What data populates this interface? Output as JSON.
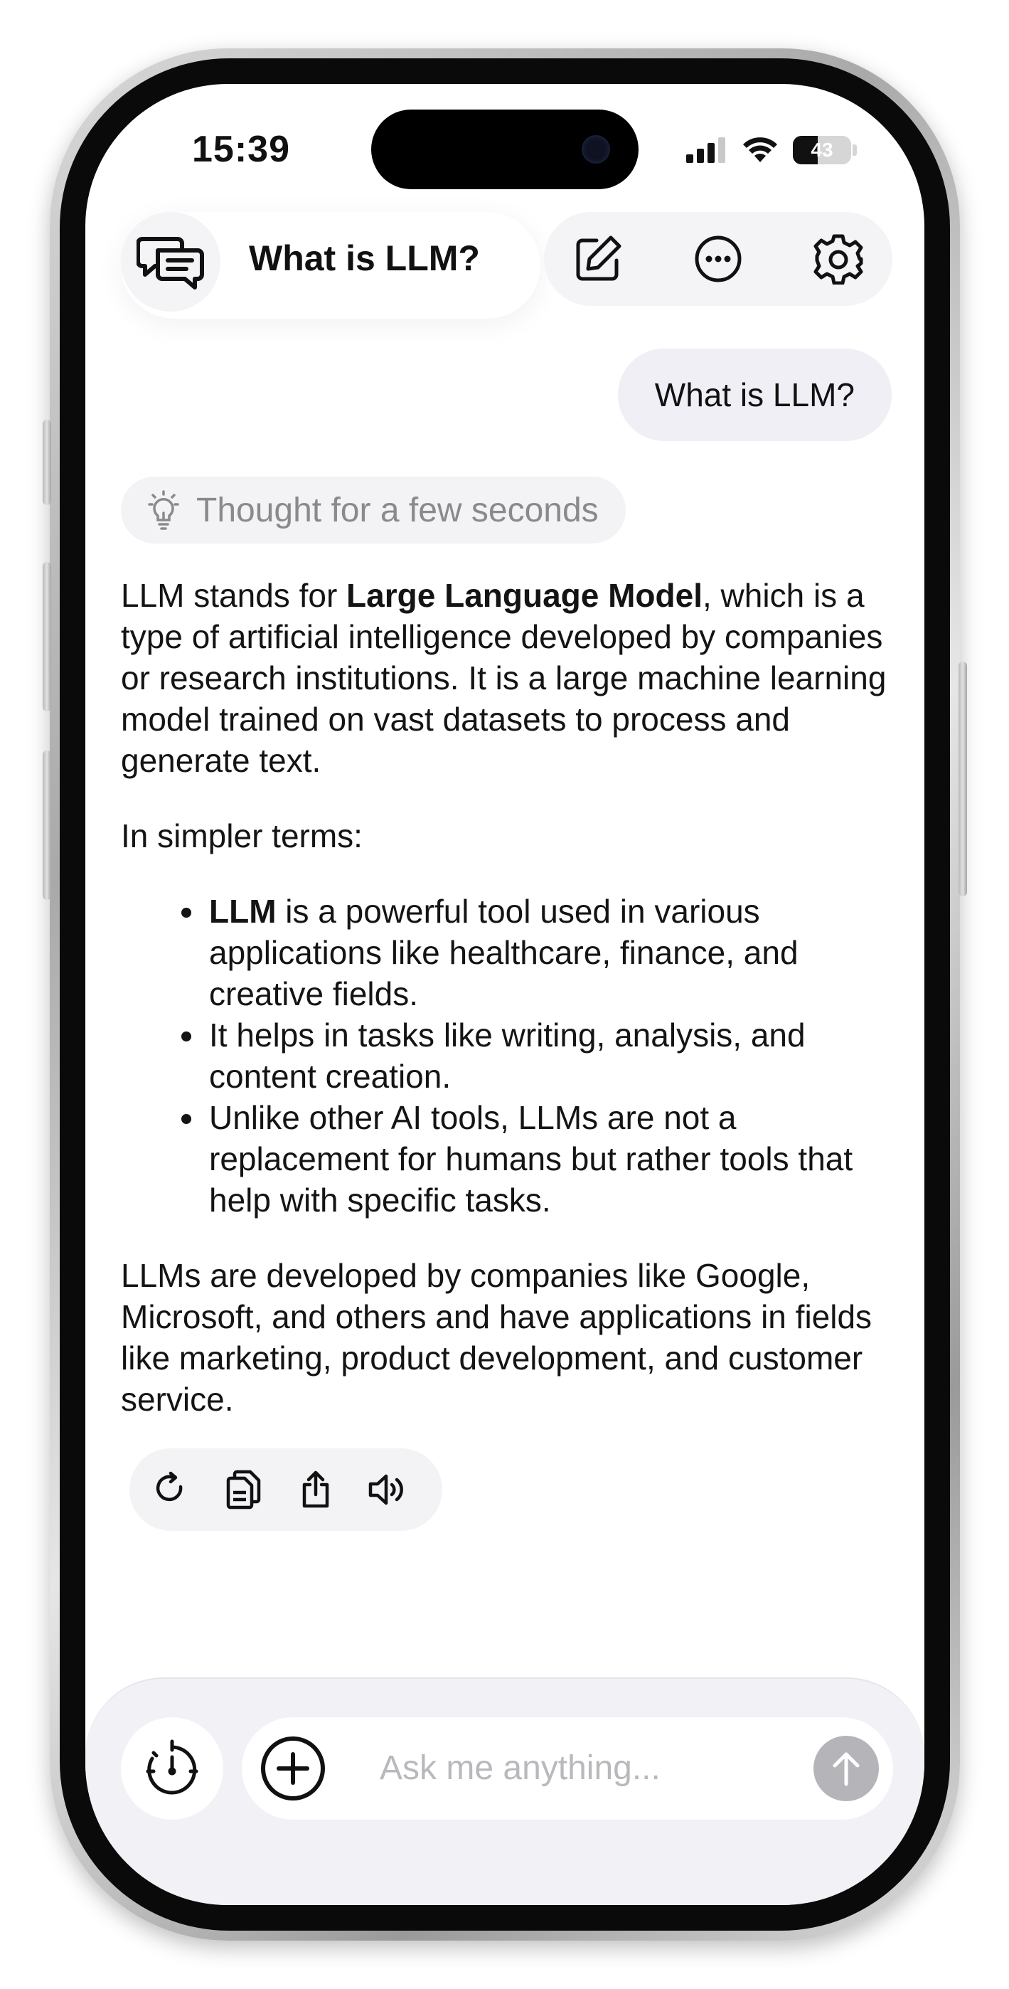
{
  "status_bar": {
    "time": "15:39",
    "battery_percent": "43",
    "battery_level": 0.43
  },
  "header": {
    "title": "What is LLM?"
  },
  "icons": {
    "chats": "chat-bubbles-icon",
    "new_chat": "edit-icon",
    "more": "more-icon",
    "settings": "gear-icon",
    "thought": "lightbulb-icon",
    "regenerate": "refresh-icon",
    "copy": "copy-icon",
    "share": "share-icon",
    "speak": "speaker-icon",
    "timer": "timer-icon",
    "attach": "plus-circle-icon",
    "send": "arrow-up-icon"
  },
  "conversation": {
    "user_message": "What is LLM?",
    "thought_label": "Thought for a few seconds",
    "answer": {
      "p1_before": "LLM stands for ",
      "p1_bold": "Large Language Model",
      "p1_after": ", which is a type of artificial intelligence developed by companies or research institutions. It is a large machine learning model trained on vast datasets to process and generate text.",
      "p2": "In simpler terms:",
      "bullets": [
        {
          "bold": "LLM",
          "text": " is a powerful tool used in various applications like healthcare, finance, and creative fields."
        },
        {
          "bold": "",
          "text": "It helps in tasks like writing, analysis, and content creation."
        },
        {
          "bold": "",
          "text": "Unlike other AI tools, LLMs are not a replacement for humans but rather tools that help with specific tasks."
        }
      ],
      "p3": "LLMs are developed by companies like Google, Microsoft, and others and have applications in fields like marketing, product development, and customer service."
    }
  },
  "composer": {
    "placeholder": "Ask me anything..."
  },
  "colors": {
    "accent_gray": "#b5b5b9",
    "bubble": "#efeff5",
    "chip": "#f3f3f5"
  }
}
